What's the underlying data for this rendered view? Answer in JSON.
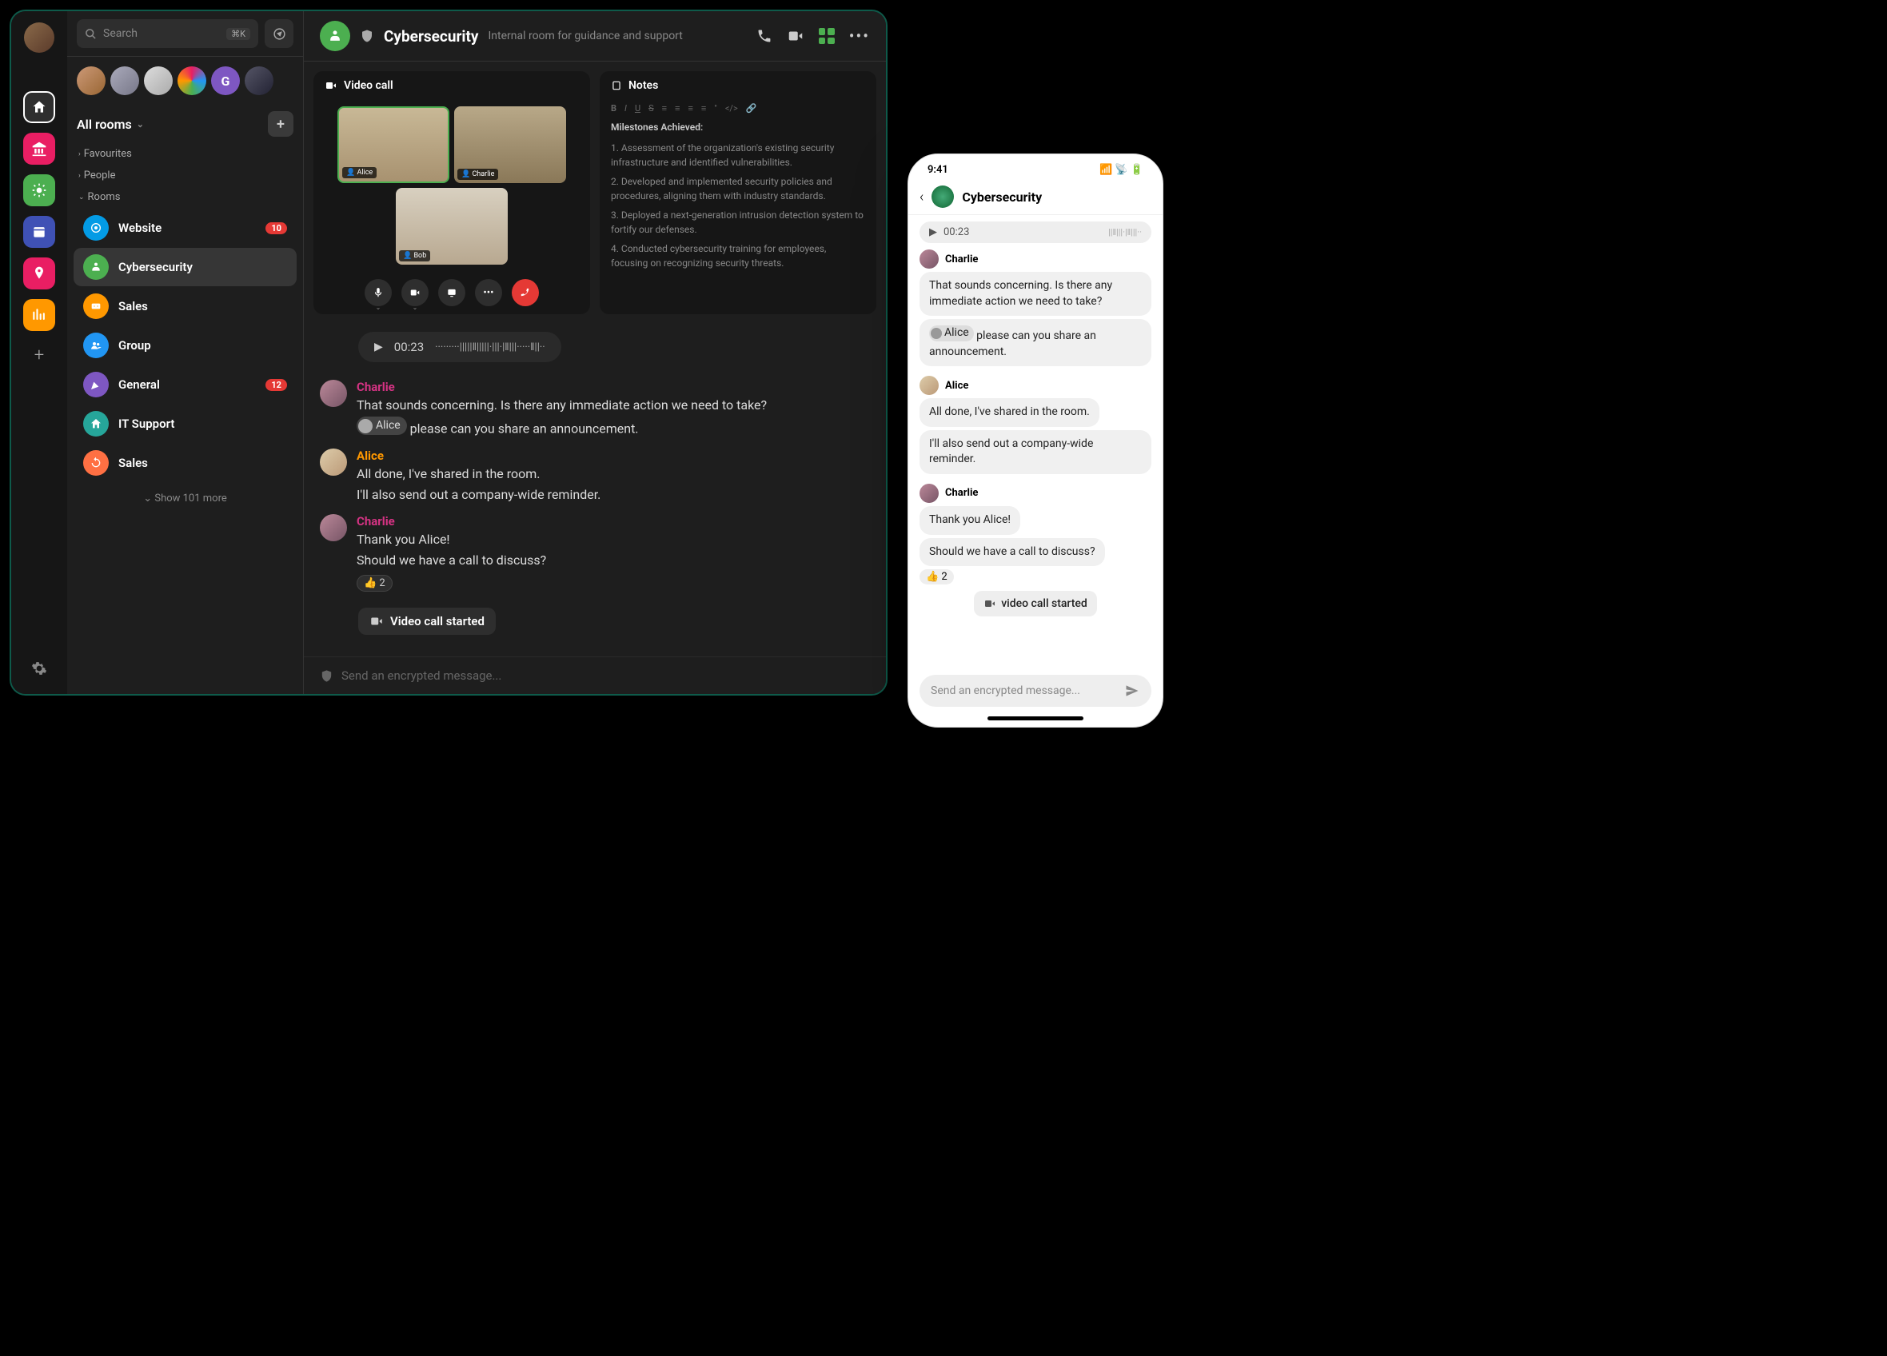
{
  "sidebar": {
    "search_placeholder": "Search",
    "search_shortcut": "⌘K",
    "all_rooms": "All rooms",
    "categories": {
      "favourites": "Favourites",
      "people": "People",
      "rooms": "Rooms"
    },
    "rooms": [
      {
        "name": "Website",
        "icon": "target",
        "color": "#039be5",
        "badge": "10"
      },
      {
        "name": "Cybersecurity",
        "icon": "bug",
        "color": "#4caf50",
        "active": true
      },
      {
        "name": "Sales",
        "icon": "ticket",
        "color": "#ff9800"
      },
      {
        "name": "Group",
        "icon": "people",
        "color": "#2196f3"
      },
      {
        "name": "General",
        "icon": "party",
        "color": "#7e57c2",
        "badge": "12"
      },
      {
        "name": "IT Support",
        "icon": "house",
        "color": "#26a69a"
      },
      {
        "name": "Sales",
        "icon": "sync",
        "color": "#ff7043"
      }
    ],
    "show_more": "Show 101 more"
  },
  "nav": {
    "items": [
      "home",
      "bank",
      "sun",
      "calendar",
      "pin",
      "chart"
    ]
  },
  "room": {
    "title": "Cybersecurity",
    "description": "Internal room for guidance and support",
    "video_panel": "Video call",
    "notes_panel": "Notes"
  },
  "video": {
    "participants": [
      "Alice",
      "Charlie",
      "Bob"
    ]
  },
  "notes": {
    "title": "Milestones Achieved:",
    "items": [
      "1. Assessment of the organization's existing security infrastructure and identified vulnerabilities.",
      "2. Developed and implemented security policies and procedures, aligning them with industry standards.",
      "3. Deployed a next-generation intrusion detection system to fortify our defenses.",
      "4. Conducted cybersecurity training for employees, focusing on recognizing security threats."
    ]
  },
  "audio": {
    "duration": "00:23"
  },
  "messages": [
    {
      "author": "Charlie",
      "class": "charlie",
      "lines": [
        "That sounds concerning. Is there any immediate action we need to take?"
      ],
      "mention_line": {
        "mention": "Alice",
        "rest": " please can you share an announcement."
      }
    },
    {
      "author": "Alice",
      "class": "alice",
      "lines": [
        "All done, I've shared in the room.",
        "I'll also send out a company-wide reminder."
      ]
    },
    {
      "author": "Charlie",
      "class": "charlie",
      "lines": [
        "Thank you Alice!",
        "Should we have a call to discuss?"
      ],
      "reaction": {
        "emoji": "👍",
        "count": "2"
      }
    }
  ],
  "event": {
    "label": "Video call started"
  },
  "composer": {
    "placeholder": "Send an encrypted message..."
  },
  "mobile": {
    "time": "9:41",
    "title": "Cybersecurity",
    "audio_time": "00:23",
    "messages": [
      {
        "author": "Charlie",
        "bubbles": [
          "That sounds concerning. Is there any immediate action we need to take?"
        ],
        "mention_bubble": {
          "mention": "Alice",
          "rest": " please can you share an announcement."
        }
      },
      {
        "author": "Alice",
        "bubbles": [
          "All done, I've shared in the room.",
          "I'll also send out a company-wide reminder."
        ]
      },
      {
        "author": "Charlie",
        "bubbles": [
          "Thank you Alice!",
          "Should we have a call to discuss?"
        ],
        "reaction": {
          "emoji": "👍",
          "count": "2"
        }
      }
    ],
    "event": "video call started",
    "composer": "Send an encrypted message..."
  },
  "colors": {
    "nav": [
      "#2e2e2e",
      "#e91e63",
      "#4caf50",
      "#3f51b5",
      "#e91e63",
      "#ff9800"
    ]
  }
}
